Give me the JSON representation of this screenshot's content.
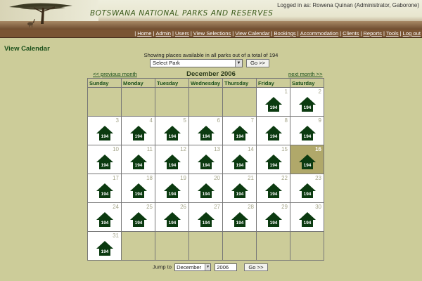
{
  "header": {
    "site_title": "BOTSWANA NATIONAL PARKS AND RESERVES",
    "login_text": "Logged in as: Rowena Quinan (Administrator, Gaborone)"
  },
  "nav": {
    "items": [
      "Home",
      "Admin",
      "Users",
      "View Selections",
      "View Calendar",
      "Bookings",
      "Accommodation",
      "Clients",
      "Reports",
      "Tools",
      "Log out"
    ]
  },
  "page": {
    "title": "View Calendar",
    "info": "Showing places available in all parks out of a total of 194",
    "park_select": "Select Park",
    "go_label": "Go >>"
  },
  "calendar": {
    "month_title": "December 2006",
    "prev_label": "<< previous month",
    "next_label": "next month >>",
    "weekdays": [
      "Sunday",
      "Monday",
      "Tuesday",
      "Wednesday",
      "Thursday",
      "Friday",
      "Saturday"
    ],
    "first_weekday_index": 5,
    "days_in_month": 31,
    "today": 16,
    "availability": 194
  },
  "jump": {
    "label": "Jump to",
    "month": "December",
    "year": "2006",
    "go_label": "Go >>"
  },
  "colors": {
    "background": "#cccc99",
    "accent_green": "#1a4f1a",
    "house": "#0b3a10",
    "today": "#b0a86a",
    "navbar": "#7a5533"
  }
}
